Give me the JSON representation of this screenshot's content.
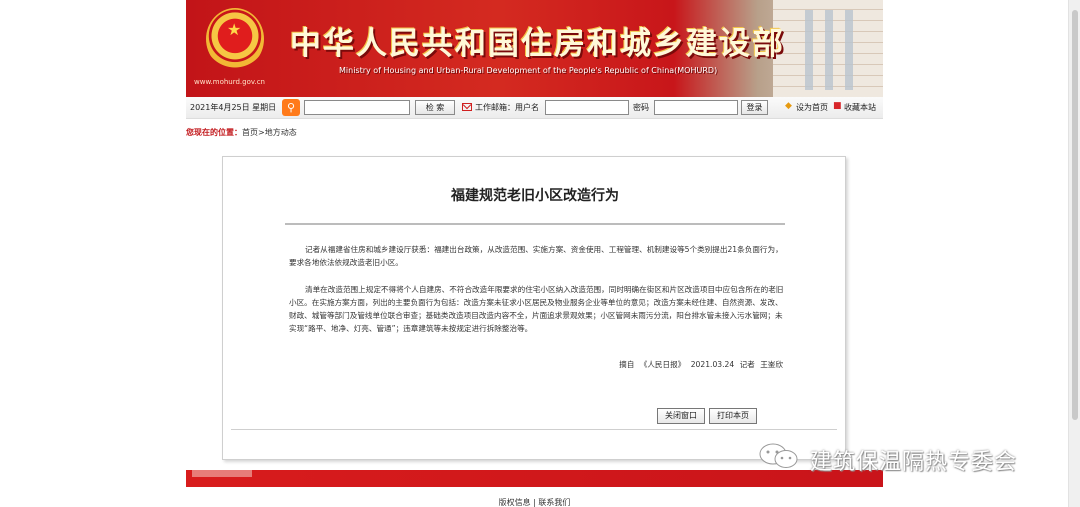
{
  "header": {
    "site_url": "www.mohurd.gov.cn",
    "title_cn": "中华人民共和国住房和城乡建设部",
    "title_en": "Ministry of Housing and Urban-Rural Development of the People's Republic of China(MOHURD)"
  },
  "toolbar": {
    "date": "2021年4月25日 星期日",
    "search_value": "",
    "search_button": "检 索",
    "mail_label": "工作邮箱：用户名",
    "username_value": "",
    "password_label": "密码",
    "password_value": "",
    "login_button": "登录",
    "homepage_link": "设为首页",
    "favorite_link": "收藏本站"
  },
  "breadcrumb": {
    "label": "您现在的位置：",
    "home": "首页",
    "separator": ">",
    "current": "地方动态"
  },
  "article": {
    "title": "福建规范老旧小区改造行为",
    "paragraphs": [
      "记者从福建省住房和城乡建设厅获悉：福建出台政策，从改造范围、实施方案、资金使用、工程管理、机制建设等5个类别提出21条负面行为，要求各地依法依规改造老旧小区。",
      "清单在改造范围上规定不得将个人自建房、不符合改造年限要求的住宅小区纳入改造范围，同时明确在街区和片区改造项目中应包含所在的老旧小区。在实施方案方面，列出的主要负面行为包括：改造方案未征求小区居民及物业服务企业等单位的意见；改造方案未经住建、自然资源、发改、财政、城管等部门及管线单位联合审查；基础类改造项目改造内容不全，片面追求景观效果；小区管网未雨污分流，阳台排水管未接入污水管网；未实现“路平、地净、灯亮、管通”；违章建筑等未按规定进行拆除整治等。"
    ],
    "source": "摘自 《人民日报》 2021.03.24 记者 王崟欣",
    "close_button": "关闭窗口",
    "print_button": "打印本页"
  },
  "footer": {
    "copyright_link": "版权信息",
    "divider": "|",
    "contact_link": "联系我们"
  },
  "watermark": {
    "text": "建筑保温隔热专委会"
  }
}
